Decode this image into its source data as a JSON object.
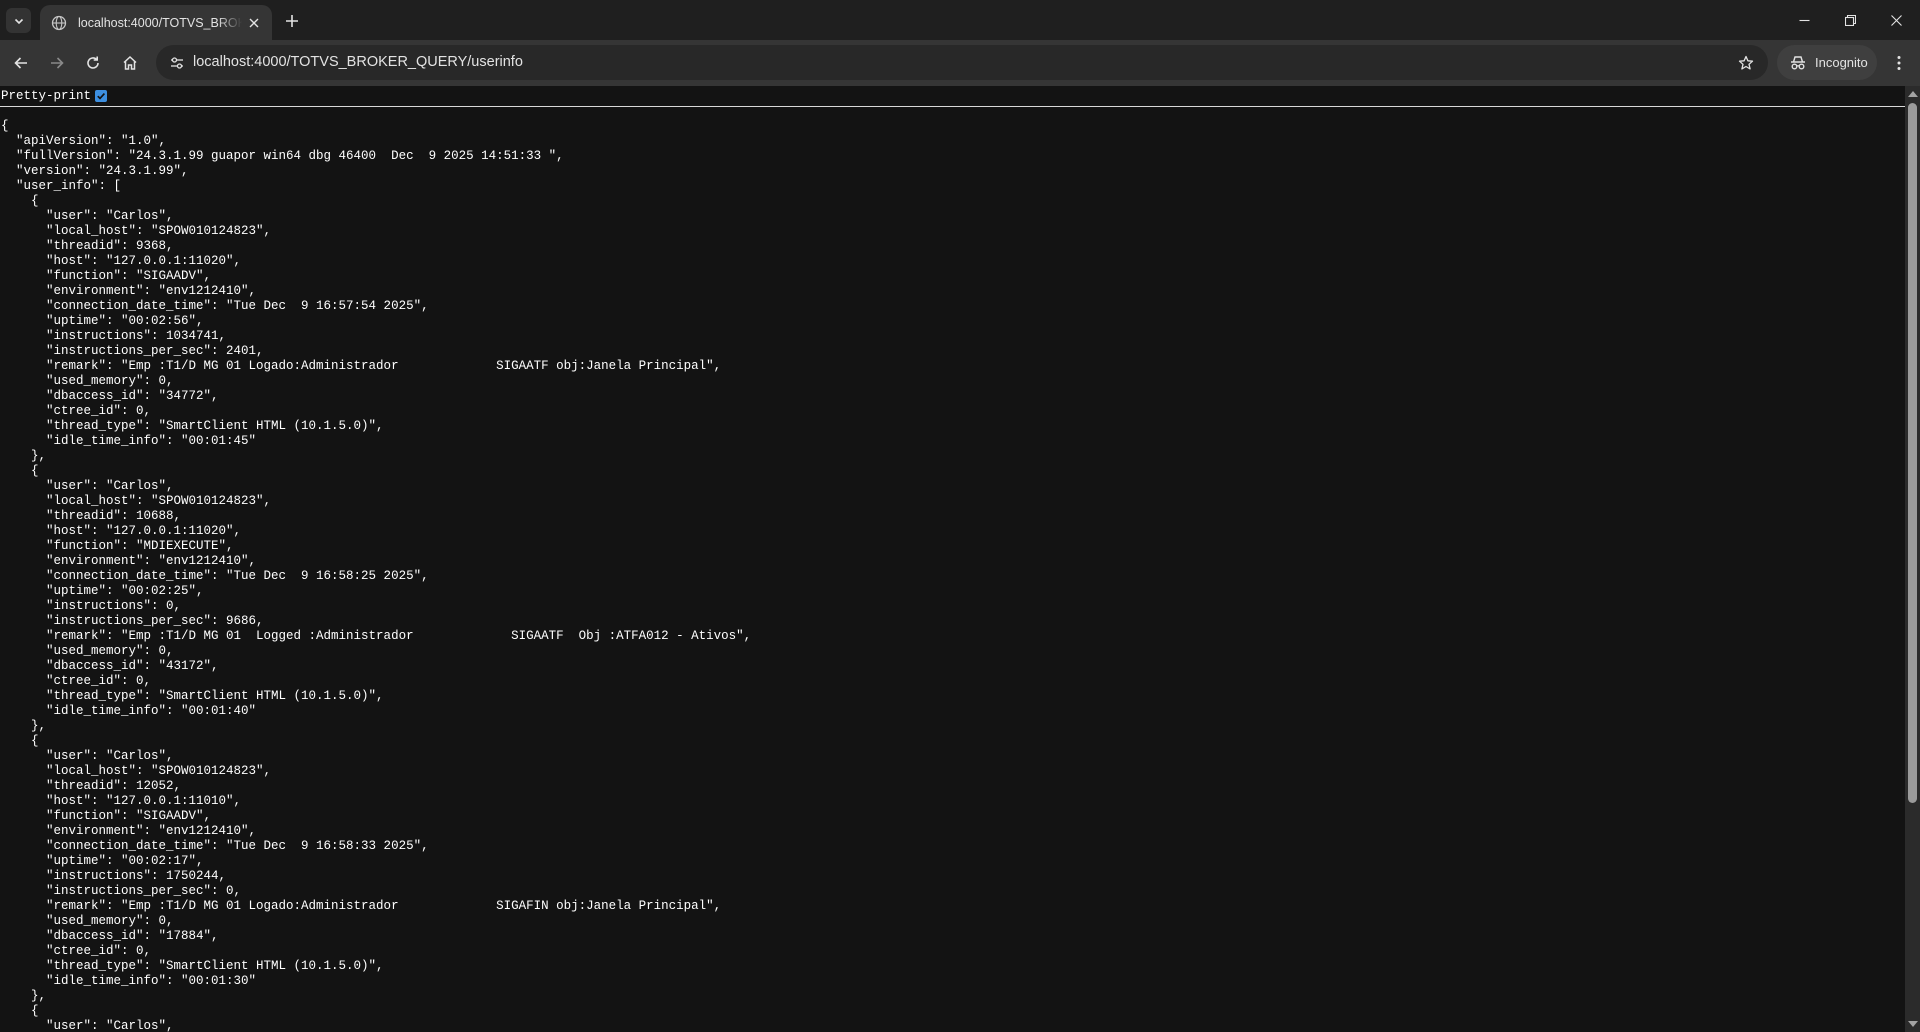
{
  "browser": {
    "tab_title": "localhost:4000/TOTVS_BROKER_QUERY/userinfo",
    "url": "localhost:4000/TOTVS_BROKER_QUERY/userinfo",
    "profile_label": "Incognito",
    "icons": {
      "tab_search": "chevron-down-icon",
      "tab_favicon": "globe-icon",
      "tab_close": "close-icon",
      "new_tab": "plus-icon",
      "back": "arrow-left-icon",
      "forward": "arrow-right-icon",
      "reload": "reload-icon",
      "home": "home-icon",
      "site_info": "tune-icon",
      "bookmark": "star-icon",
      "incognito": "incognito-icon",
      "menu": "kebab-icon"
    }
  },
  "page": {
    "pretty_print_label": "Pretty-print",
    "pretty_print_checked": true,
    "json": {
      "apiVersion": "1.0",
      "fullVersion": "24.3.1.99 guapor win64 dbg 46400  Dec  9 2025 14:51:33 ",
      "version": "24.3.1.99",
      "user_info": [
        {
          "user": "Carlos",
          "local_host": "SPOW010124823",
          "threadid": 9368,
          "host": "127.0.0.1:11020",
          "function": "SIGAADV",
          "environment": "env1212410",
          "connection_date_time": "Tue Dec  9 16:57:54 2025",
          "uptime": "00:02:56",
          "instructions": 1034741,
          "instructions_per_sec": 2401,
          "remark": "Emp :T1/D MG 01 Logado:Administrador             SIGAATF obj:Janela Principal",
          "used_memory": 0,
          "dbaccess_id": "34772",
          "ctree_id": 0,
          "thread_type": "SmartClient HTML (10.1.5.0)",
          "idle_time_info": "00:01:45"
        },
        {
          "user": "Carlos",
          "local_host": "SPOW010124823",
          "threadid": 10688,
          "host": "127.0.0.1:11020",
          "function": "MDIEXECUTE",
          "environment": "env1212410",
          "connection_date_time": "Tue Dec  9 16:58:25 2025",
          "uptime": "00:02:25",
          "instructions": 0,
          "instructions_per_sec": 9686,
          "remark": "Emp :T1/D MG 01  Logged :Administrador             SIGAATF  Obj :ATFA012 - Ativos",
          "used_memory": 0,
          "dbaccess_id": "43172",
          "ctree_id": 0,
          "thread_type": "SmartClient HTML (10.1.5.0)",
          "idle_time_info": "00:01:40"
        },
        {
          "user": "Carlos",
          "local_host": "SPOW010124823",
          "threadid": 12052,
          "host": "127.0.0.1:11010",
          "function": "SIGAADV",
          "environment": "env1212410",
          "connection_date_time": "Tue Dec  9 16:58:33 2025",
          "uptime": "00:02:17",
          "instructions": 1750244,
          "instructions_per_sec": 0,
          "remark": "Emp :T1/D MG 01 Logado:Administrador             SIGAFIN obj:Janela Principal",
          "used_memory": 0,
          "dbaccess_id": "17884",
          "ctree_id": 0,
          "thread_type": "SmartClient HTML (10.1.5.0)",
          "idle_time_info": "00:01:30"
        },
        {
          "user": "Carlos"
        }
      ]
    }
  }
}
